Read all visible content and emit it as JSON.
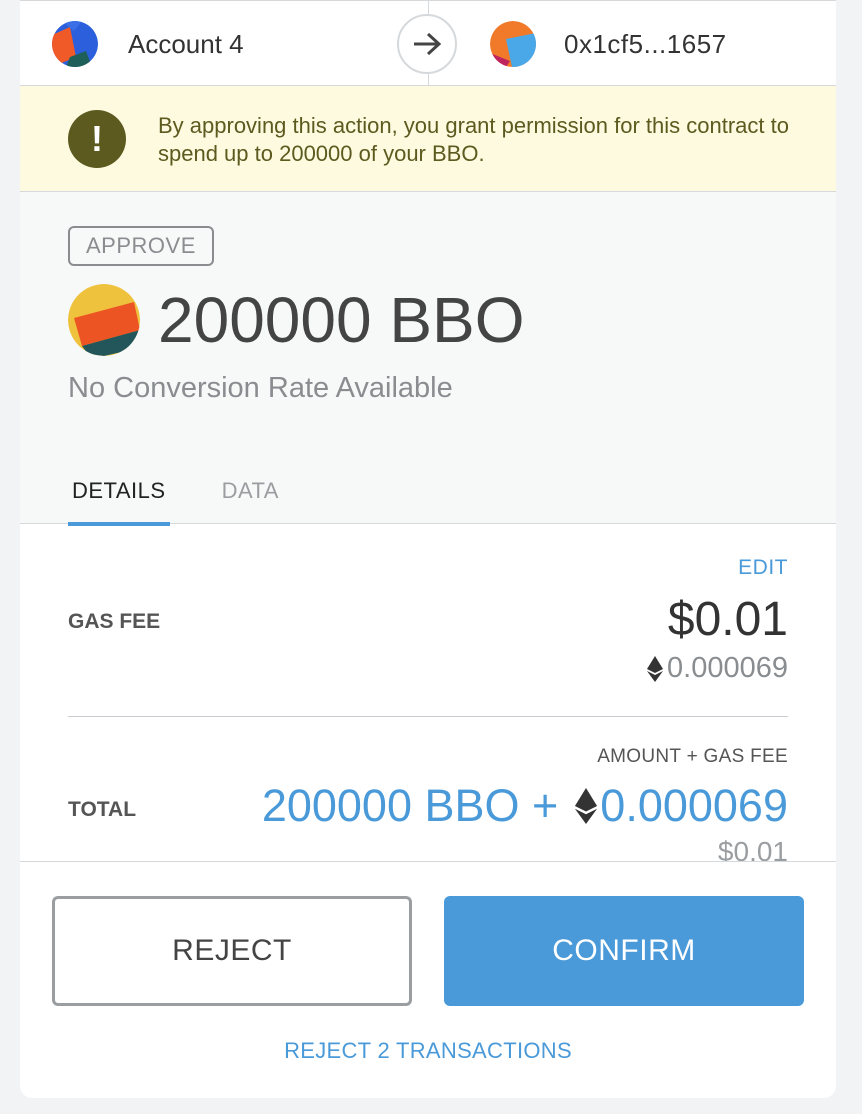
{
  "header": {
    "from_account": "Account 4",
    "to_address": "0x1cf5...1657",
    "arrow_icon": "arrow-right-icon"
  },
  "warning": {
    "icon": "exclamation-icon",
    "icon_glyph": "!",
    "message": "By approving this action, you grant permission for this contract to spend up to 200000 of your BBO."
  },
  "summary": {
    "action_badge": "APPROVE",
    "token_amount": "200000 BBO",
    "conversion_text": "No Conversion Rate Available"
  },
  "tabs": [
    {
      "label": "DETAILS",
      "active": true
    },
    {
      "label": "DATA",
      "active": false
    }
  ],
  "details": {
    "edit_label": "EDIT",
    "gas_fee_label": "GAS FEE",
    "gas_fee_fiat": "$0.01",
    "gas_fee_eth": "0.000069",
    "total_sublabel": "AMOUNT + GAS FEE",
    "total_label": "TOTAL",
    "total_amount_prefix": "200000 BBO +",
    "total_amount_eth": "0.000069",
    "total_fiat": "$0.01"
  },
  "footer": {
    "reject_label": "REJECT",
    "confirm_label": "CONFIRM",
    "reject_all_label": "REJECT 2 TRANSACTIONS"
  },
  "colors": {
    "accent": "#4a9ad9",
    "warning_bg": "#fefae0",
    "warning_icon": "#5d5a1f"
  }
}
